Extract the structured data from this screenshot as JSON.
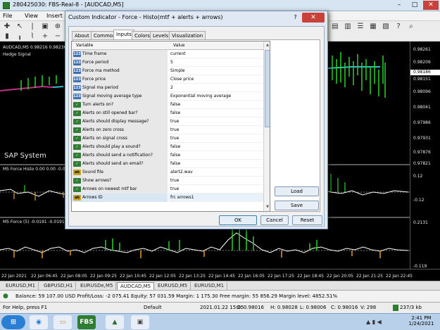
{
  "window": {
    "title": "280425030: FBS-Real-8 - [AUDCAD,M5]",
    "controls": [
      "–",
      "□",
      "✕"
    ]
  },
  "menu": [
    "File",
    "View",
    "Insert"
  ],
  "chart": {
    "symbol_label": "AUDCAD,M5",
    "ohlc_text": "0.98216 0.98236 0",
    "indicator_label": "Hedge Signal",
    "watermark": "SAP System",
    "subwindow1_label": "M5 Force Histo 0.00 0.00 -0.02 -0",
    "subwindow2_label": "M5 Force (5) -0.0191 -0.0191 -0",
    "price_scale": [
      "0.98261",
      "0.98206",
      "0.98151",
      "0.98096",
      "0.98041",
      "0.97986",
      "0.97931",
      "0.97876",
      "0.97821"
    ],
    "current_price": "0.98186",
    "sub1_scale": [
      "0.12",
      "-0.12"
    ],
    "sub2_scale": [
      "0.2131",
      "-0.119"
    ],
    "time_labels": [
      "22 Jan 2021",
      "22 Jan 06:45",
      "22 Jan 08:05",
      "22 Jan 09:25",
      "22 Jan 10:45",
      "22 Jan 12:05",
      "22 Jan 13:25",
      "22 Jan 14:45",
      "22 Jan 16:05",
      "22 Jan 17:25",
      "22 Jan 18:45",
      "22 Jan 20:05",
      "22 Jan 21:25",
      "22 Jan 22:45"
    ]
  },
  "chart_tabs": [
    "EURUSD,M1",
    "GBPUSD,H1",
    "EURUSDe,M5",
    "AUDCAD,M5",
    "EURUSD,M5",
    "EURUSD,M1"
  ],
  "active_chart_tab": "AUDCAD,M5",
  "toolbox_text": "Balance: 59 107.00 USD  Profit/Loss: -2 075.41  Equity: 57 031.59  Margin: 1 175.30  Free margin: 55 856.29  Margin level: 4852.51%",
  "statusbar": {
    "help": "For Help, press F1",
    "profile": "Default",
    "datetime": "2021.01.22 15:05",
    "open": "O: 0.98016",
    "high": "H: 0.98028",
    "low": "L: 0.98006",
    "close": "C: 0.98016",
    "volume": "V: 298",
    "traffic": "237/3 kb"
  },
  "taskbar": {
    "time": "2:41 PM",
    "date": "1/24/2021"
  },
  "dialog": {
    "title": "Custom Indicator - Force -  Histo(mtf + alerts + arrows)",
    "help": "?",
    "close": "✕",
    "tabs": [
      "About",
      "Common",
      "Inputs",
      "Colors",
      "Levels",
      "Visualization"
    ],
    "active_tab": "Inputs",
    "columns": [
      "Variable",
      "Value"
    ],
    "params": [
      {
        "icon": "int",
        "name": "Time frame",
        "value": "current"
      },
      {
        "icon": "int",
        "name": "Force period",
        "value": "5"
      },
      {
        "icon": "int",
        "name": "Force ma method",
        "value": "Simple"
      },
      {
        "icon": "int",
        "name": "Force price",
        "value": "Close price"
      },
      {
        "icon": "int",
        "name": "Signal ma period",
        "value": "2"
      },
      {
        "icon": "int",
        "name": "Signal moving average type",
        "value": "Exponential moving average"
      },
      {
        "icon": "bool",
        "name": "Turn alerts on?",
        "value": "false"
      },
      {
        "icon": "bool",
        "name": "Alerts on still opened bar?",
        "value": "false"
      },
      {
        "icon": "bool",
        "name": "Alerts should display message?",
        "value": "true"
      },
      {
        "icon": "bool",
        "name": "Alerts on zero cross",
        "value": "true"
      },
      {
        "icon": "bool",
        "name": "Alerts on signal cross",
        "value": "true"
      },
      {
        "icon": "bool",
        "name": "Alerts should play a sound?",
        "value": "false"
      },
      {
        "icon": "bool",
        "name": "Alerts should send a notification?",
        "value": "false"
      },
      {
        "icon": "bool",
        "name": "Alerts should send an email?",
        "value": "false"
      },
      {
        "icon": "str",
        "name": "Sound file",
        "value": "alert2.wav"
      },
      {
        "icon": "bool",
        "name": "Show arrows?",
        "value": "true"
      },
      {
        "icon": "bool",
        "name": "Arrows on newest mtf bar",
        "value": "true"
      },
      {
        "icon": "str",
        "name": "Arrows ID",
        "value": "frc arrows1"
      }
    ],
    "load_label": "Load",
    "save_label": "Save",
    "ok_label": "OK",
    "cancel_label": "Cancel",
    "reset_label": "Reset"
  }
}
